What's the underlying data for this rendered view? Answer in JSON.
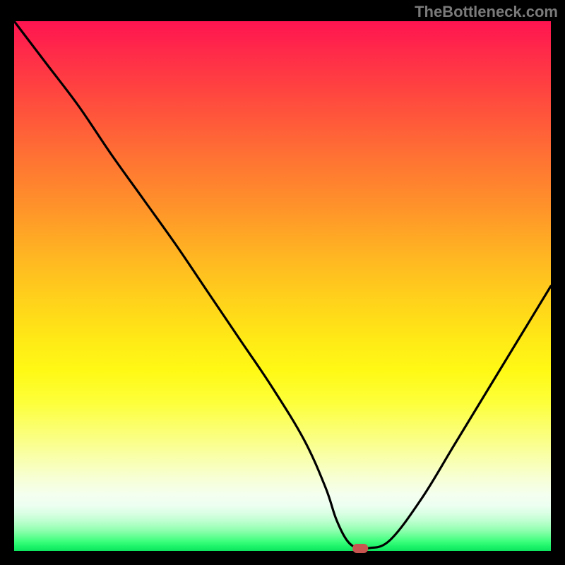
{
  "watermark": "TheBottleneck.com",
  "chart_data": {
    "type": "line",
    "title": "",
    "xlabel": "",
    "ylabel": "",
    "xlim": [
      0,
      100
    ],
    "ylim": [
      0,
      100
    ],
    "background_gradient": {
      "top_color": "#ff1450",
      "bottom_color": "#0de55e",
      "description": "vertical rainbow gradient red→orange→yellow→pale→green"
    },
    "series": [
      {
        "name": "bottleneck-curve",
        "x": [
          0,
          6,
          12,
          18,
          24,
          30,
          36,
          42,
          48,
          54,
          58,
          60,
          62,
          64,
          66,
          70,
          76,
          82,
          88,
          94,
          100
        ],
        "y": [
          100,
          92,
          84,
          75,
          66.5,
          58,
          49,
          40,
          31,
          21,
          12,
          6,
          2,
          0.5,
          0.5,
          2,
          10,
          20,
          30,
          40,
          50
        ],
        "note": "y is percent height of plot area; 0 at bottom"
      }
    ],
    "marker": {
      "name": "optimal-point",
      "x": 64.5,
      "y": 0.4,
      "shape": "rounded-rect",
      "color": "#c8554f"
    }
  }
}
